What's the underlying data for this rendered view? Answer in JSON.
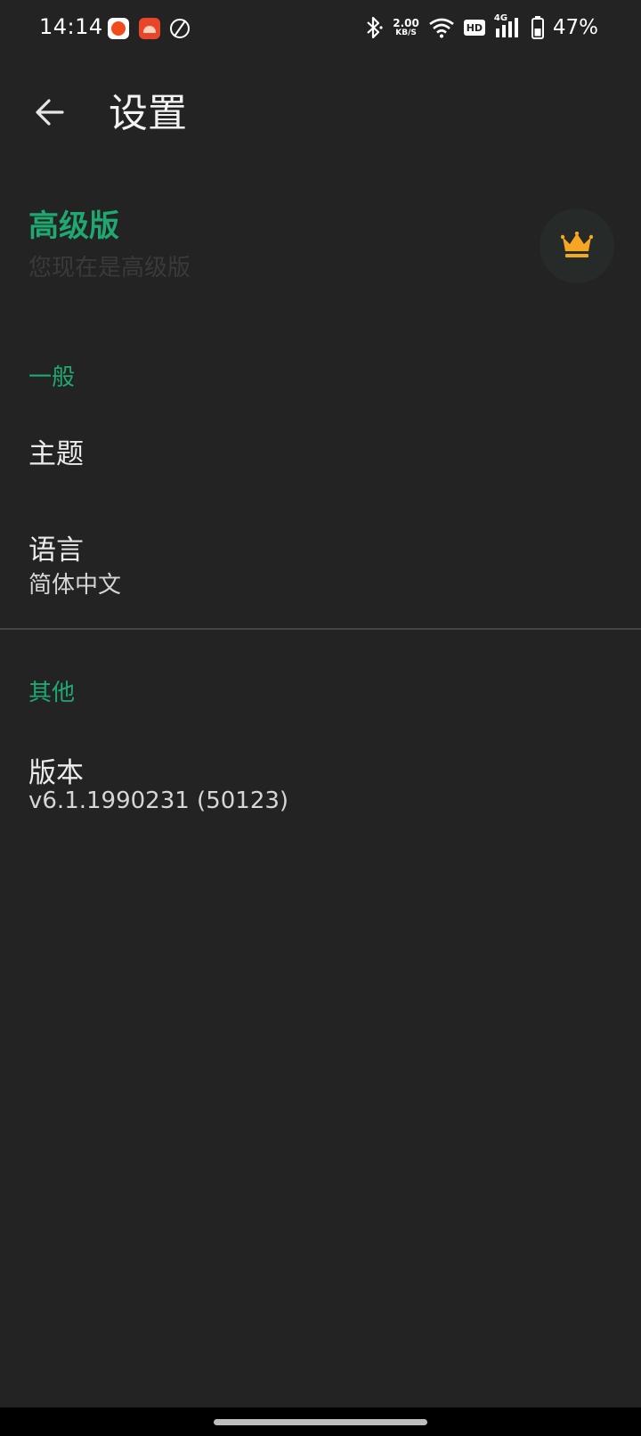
{
  "status_bar": {
    "time": "14:14",
    "net_speed_value": "2.00",
    "net_speed_unit": "KB/S",
    "hd_label": "HD",
    "signal_label": "4G",
    "battery_percent": "47%",
    "icons": [
      "bluetooth-icon",
      "wifi-icon",
      "hd-icon",
      "signal-icon",
      "battery-icon"
    ]
  },
  "app_bar": {
    "title": "设置",
    "back_icon": "arrow-left-icon"
  },
  "premium": {
    "title": "高级版",
    "subtitle": "您现在是高级版",
    "icon": "crown-icon",
    "accent_color": "#1fa870",
    "crown_color": "#f5a623"
  },
  "sections": {
    "general": {
      "header": "一般",
      "theme_title": "主题",
      "language_title": "语言",
      "language_value": "简体中文"
    },
    "other": {
      "header": "其他",
      "version_title": "版本",
      "version_value": "v6.1.1990231 (50123)"
    }
  }
}
